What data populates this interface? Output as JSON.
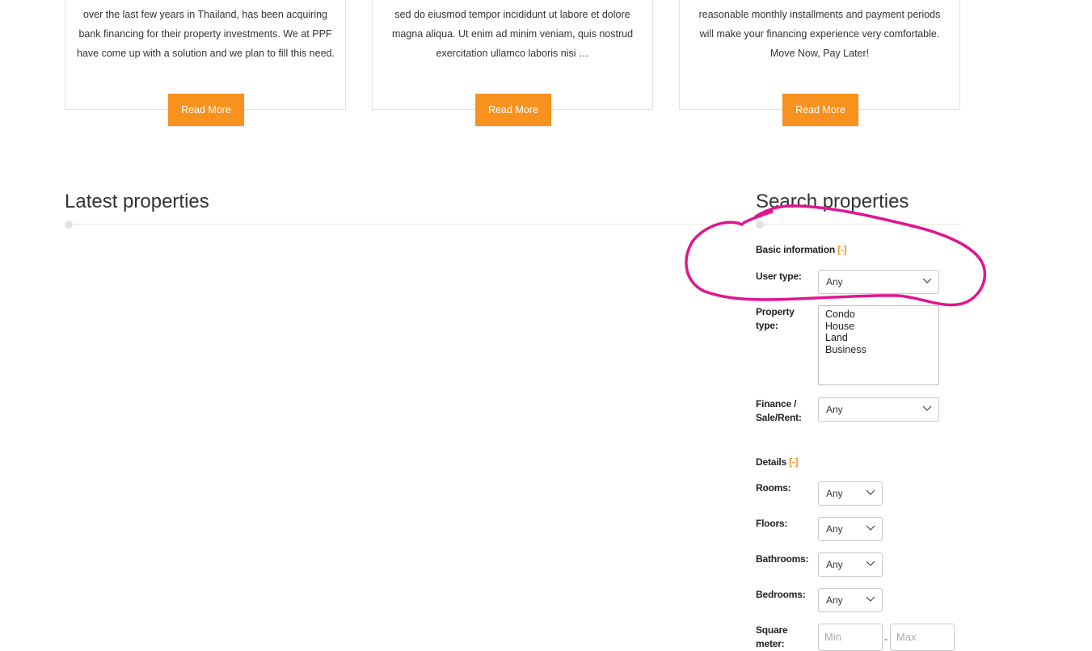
{
  "cards": [
    {
      "lines": [
        "over the last few years in Thailand, has been acquiring",
        "bank financing for their property investments. We at PPF",
        "have come up with a solution and we plan to fill this need."
      ],
      "button": "Read More"
    },
    {
      "lines": [
        "sed do eiusmod tempor incididunt ut labore et dolore",
        "magna aliqua. Ut enim ad minim veniam, quis nostrud",
        "exercitation ullamco laboris nisi …"
      ],
      "button": "Read More"
    },
    {
      "lines": [
        "reasonable monthly installments and payment periods",
        "will make your financing experience very comfortable.",
        "Move Now, Pay Later!"
      ],
      "button": "Read More"
    }
  ],
  "latest": {
    "title": "Latest properties"
  },
  "search": {
    "title": "Search properties",
    "basic_heading": "Basic information",
    "details_heading": "Details",
    "toggle": "[-]",
    "user_type": {
      "label": "User type:",
      "value": "Any"
    },
    "property_type": {
      "label": "Property type:",
      "options": [
        "Condo",
        "House",
        "Land",
        "Business"
      ]
    },
    "finance": {
      "label": "Finance / Sale/Rent:",
      "value": "Any"
    },
    "rooms": {
      "label": "Rooms:",
      "value": "Any"
    },
    "floors": {
      "label": "Floors:",
      "value": "Any"
    },
    "bathrooms": {
      "label": "Bathrooms:",
      "value": "Any"
    },
    "bedrooms": {
      "label": "Bedrooms:",
      "value": "Any"
    },
    "square_meter": {
      "label": "Square meter:",
      "min_placeholder": "Min",
      "max_placeholder": "Max",
      "separator": "-"
    }
  },
  "colors": {
    "accent": "#f7921e",
    "annotation": "#e0158f"
  },
  "icons": {
    "select_arrow": "chevron-down-icon"
  }
}
